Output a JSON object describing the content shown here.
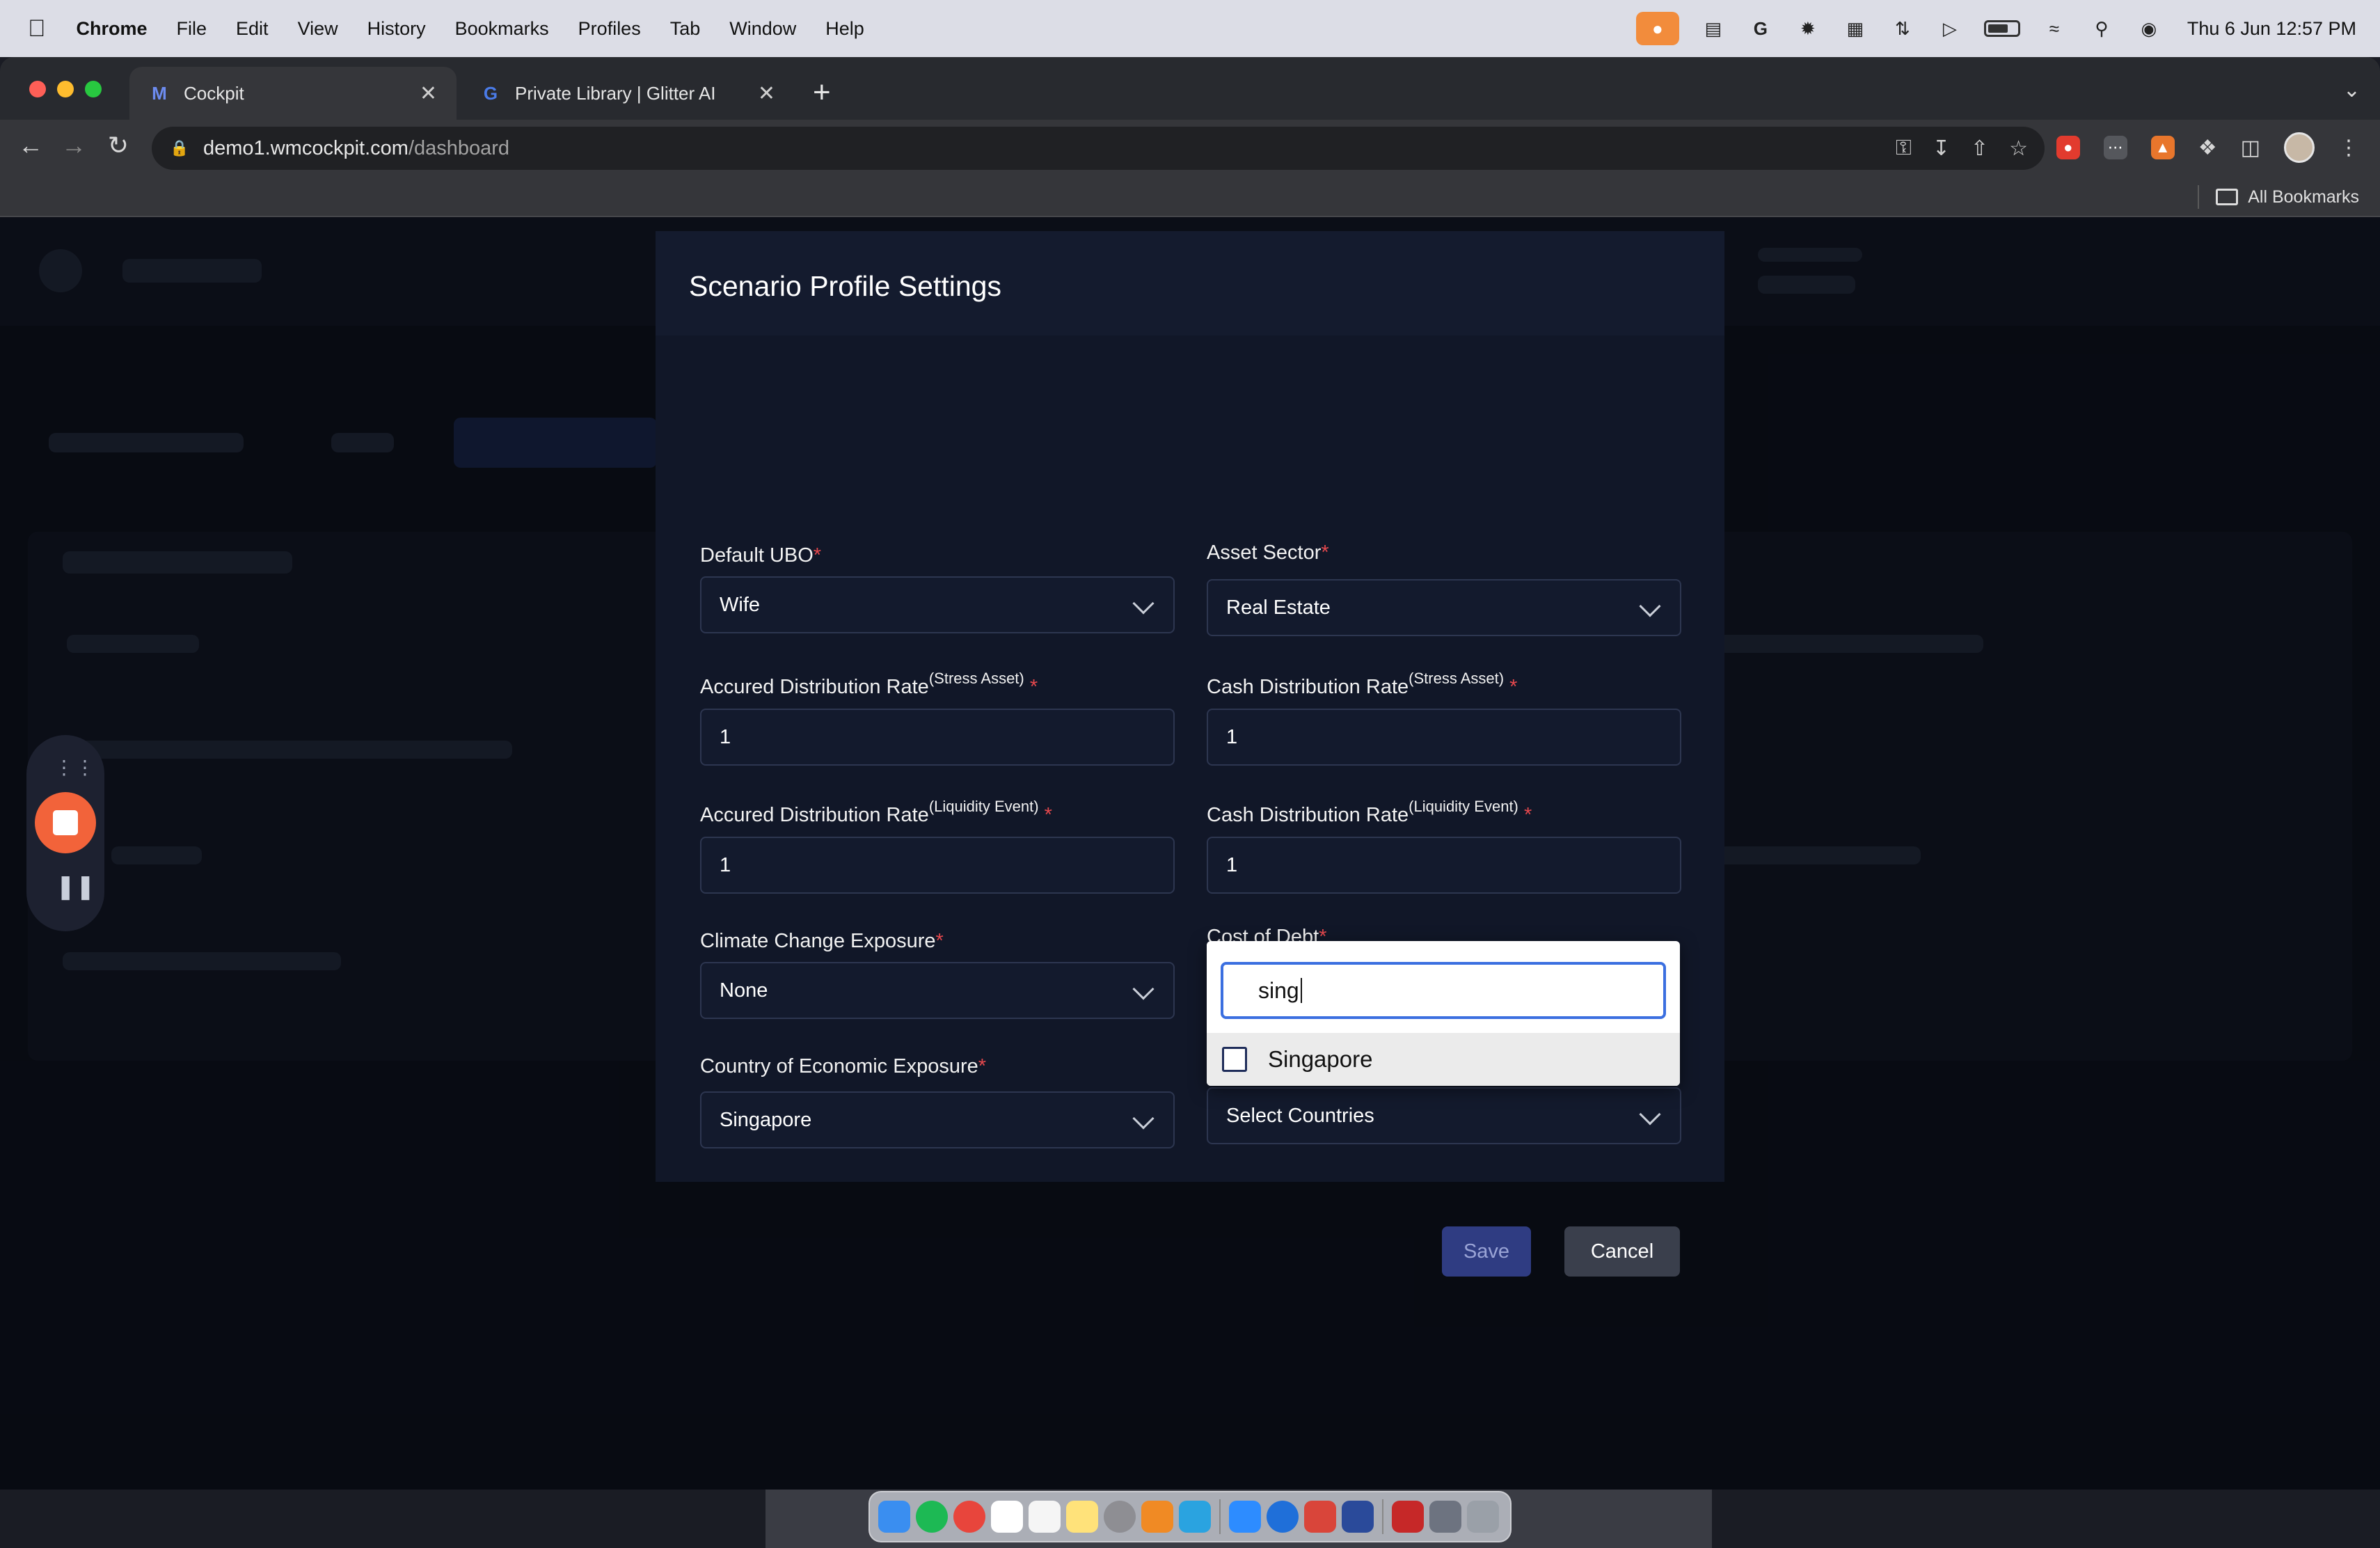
{
  "menubar": {
    "apple_icon": "apple-logo-icon",
    "app_name": "Chrome",
    "items": [
      "File",
      "Edit",
      "View",
      "History",
      "Bookmarks",
      "Profiles",
      "Tab",
      "Window",
      "Help"
    ],
    "clock": "Thu 6 Jun  12:57 PM"
  },
  "browser": {
    "tabs": [
      {
        "title": "Cockpit",
        "icon": "cockpit-logo-icon"
      },
      {
        "title": "Private Library | Glitter AI",
        "icon": "glitter-logo-icon"
      }
    ],
    "url_host": "demo1.wmcockpit.com",
    "url_path": "/dashboard",
    "bookmarks_label": "All Bookmarks"
  },
  "modal": {
    "title": "Scenario Profile Settings",
    "fields": {
      "default_ubo": {
        "label": "Default UBO",
        "value": "Wife"
      },
      "asset_sector": {
        "label": "Asset Sector",
        "value": "Real Estate"
      },
      "accured_stress": {
        "label": "Accured Distribution Rate",
        "sup": "(Stress Asset)",
        "value": "1"
      },
      "cash_stress": {
        "label": "Cash Distribution Rate",
        "sup": "(Stress Asset)",
        "value": "1"
      },
      "accured_liquidity": {
        "label": "Accured Distribution Rate",
        "sup": "(Liquidity Event)",
        "value": "1"
      },
      "cash_liquidity": {
        "label": "Cash Distribution Rate",
        "sup": "(Liquidity Event)",
        "value": "1"
      },
      "climate": {
        "label": "Climate Change Exposure",
        "value": "None"
      },
      "cost_of_debt": {
        "label": "Cost of Debt"
      },
      "economic_exposure": {
        "label": "Country of Economic Exposure",
        "value": "Singapore"
      },
      "legal_exposure": {
        "placeholder": "Select Countries"
      }
    },
    "popup": {
      "search_value": "sing",
      "option": "Singapore",
      "option_checked": false
    },
    "save_label": "Save",
    "cancel_label": "Cancel",
    "required_mark": "*"
  },
  "colors": {
    "accent_blue": "#3b6fe0",
    "required_red": "#e5484d",
    "recorder_orange": "#f2633a",
    "modal_bg": "#111728"
  }
}
